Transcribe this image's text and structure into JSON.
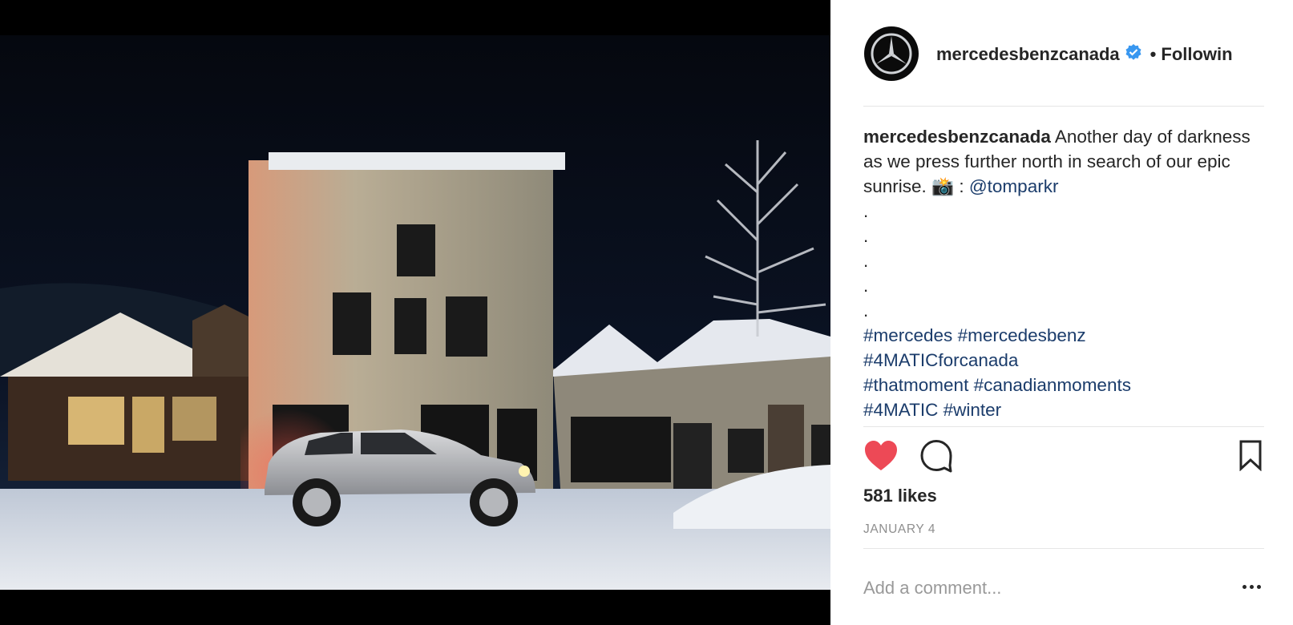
{
  "post": {
    "username": "mercedesbenzcanada",
    "separator": "•",
    "follow_label": "Followin",
    "caption": {
      "username": "mercedesbenzcanada",
      "text": " Another day of darkness as we press further north in search of our epic sunrise. ",
      "camera_emoji": "📸",
      "colon": " : ",
      "mention": "@tomparkr",
      "dots": [
        ".",
        ".",
        ".",
        ".",
        "."
      ],
      "hashtag_lines": [
        [
          "#mercedes",
          "#mercedesbenz"
        ],
        [
          "#4MATICforcanada"
        ],
        [
          "#thatmoment",
          "#canadianmoments"
        ],
        [
          "#4MATIC",
          "#winter"
        ]
      ]
    },
    "likes": "581 likes",
    "date": "JANUARY 4",
    "comment_placeholder": "Add a comment..."
  },
  "icons": {
    "avatar": "mercedes-star-logo",
    "verified": "verified-badge-icon",
    "like": "heart-filled-icon",
    "comment": "comment-bubble-icon",
    "save": "bookmark-icon",
    "more": "more-options-icon"
  },
  "colors": {
    "like": "#ed4956",
    "verified": "#3897f0",
    "link": "#1b3c6b",
    "muted": "#8e8e8e"
  }
}
